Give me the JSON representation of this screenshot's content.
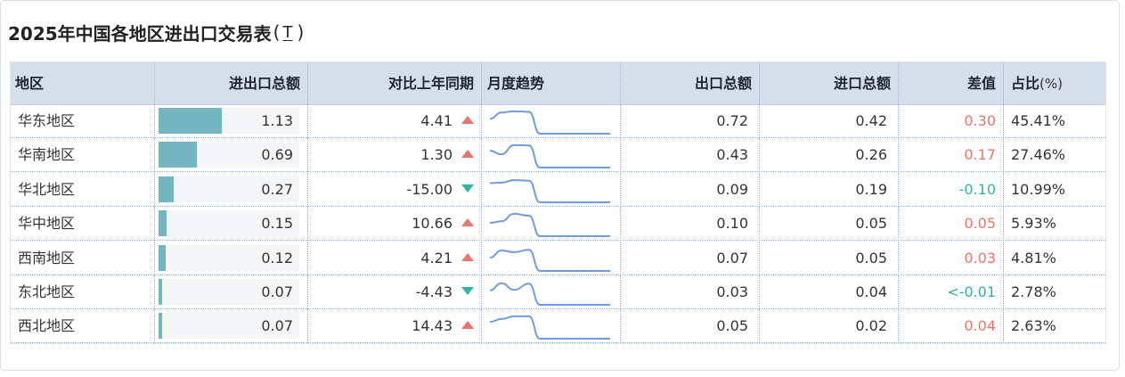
{
  "title": "2025年中国各地区进出口交易表",
  "title_paren_open": "(",
  "title_tool": "T",
  "title_paren_close": ")",
  "columns": {
    "region": "地区",
    "total": "进出口总额",
    "yoy": "对比上年同期",
    "trend": "月度趋势",
    "export": "出口总额",
    "import": "进口总额",
    "diff": "差值",
    "share": "占比",
    "share_unit": "(%)"
  },
  "colors": {
    "bar": "#74b5c0",
    "up": "#e9756b",
    "down": "#2fb6a1",
    "spark": "#6f9be0",
    "header": "#d5deea"
  },
  "bar_max": 1.13,
  "rows": [
    {
      "region": "华东地区",
      "total": "1.13",
      "total_value": 1.13,
      "yoy": "4.41",
      "dir": "up",
      "export": "0.72",
      "import": "0.42",
      "diff": "0.30",
      "diff_sign": "pos",
      "share": "45.41%",
      "trend": [
        0.62,
        0.88,
        0.93,
        0.91,
        0.0,
        0.0,
        0.0,
        0.0,
        0.0
      ]
    },
    {
      "region": "华南地区",
      "total": "0.69",
      "total_value": 0.69,
      "yoy": "1.30",
      "dir": "up",
      "export": "0.43",
      "import": "0.26",
      "diff": "0.17",
      "diff_sign": "pos",
      "share": "27.46%",
      "trend": [
        0.7,
        0.55,
        0.93,
        0.92,
        0.0,
        0.0,
        0.0,
        0.0,
        0.0
      ]
    },
    {
      "region": "华北地区",
      "total": "0.27",
      "total_value": 0.27,
      "yoy": "-15.00",
      "dir": "down",
      "export": "0.09",
      "import": "0.19",
      "diff": "-0.10",
      "diff_sign": "neg",
      "share": "10.99%",
      "trend": [
        0.8,
        0.82,
        0.92,
        0.9,
        0.0,
        0.0,
        0.0,
        0.0,
        0.0
      ]
    },
    {
      "region": "华中地区",
      "total": "0.15",
      "total_value": 0.15,
      "yoy": "10.66",
      "dir": "up",
      "export": "0.10",
      "import": "0.05",
      "diff": "0.05",
      "diff_sign": "pos",
      "share": "5.93%",
      "trend": [
        0.55,
        0.62,
        0.93,
        0.85,
        0.0,
        0.0,
        0.0,
        0.0,
        0.0
      ]
    },
    {
      "region": "西南地区",
      "total": "0.12",
      "total_value": 0.12,
      "yoy": "4.21",
      "dir": "up",
      "export": "0.07",
      "import": "0.05",
      "diff": "0.03",
      "diff_sign": "pos",
      "share": "4.81%",
      "trend": [
        0.55,
        0.85,
        0.78,
        0.88,
        0.0,
        0.0,
        0.0,
        0.0,
        0.0
      ]
    },
    {
      "region": "东北地区",
      "total": "0.07",
      "total_value": 0.07,
      "yoy": "-4.43",
      "dir": "down",
      "export": "0.03",
      "import": "0.04",
      "diff": "<-0.01",
      "diff_sign": "neg",
      "share": "2.78%",
      "trend": [
        0.6,
        0.9,
        0.62,
        0.88,
        0.0,
        0.0,
        0.0,
        0.0,
        0.0
      ]
    },
    {
      "region": "西北地区",
      "total": "0.07",
      "total_value": 0.07,
      "yoy": "14.43",
      "dir": "up",
      "export": "0.05",
      "import": "0.02",
      "diff": "0.04",
      "diff_sign": "pos",
      "share": "2.63%",
      "trend": [
        0.7,
        0.82,
        0.93,
        0.93,
        0.0,
        0.0,
        0.0,
        0.0,
        0.0
      ]
    }
  ]
}
